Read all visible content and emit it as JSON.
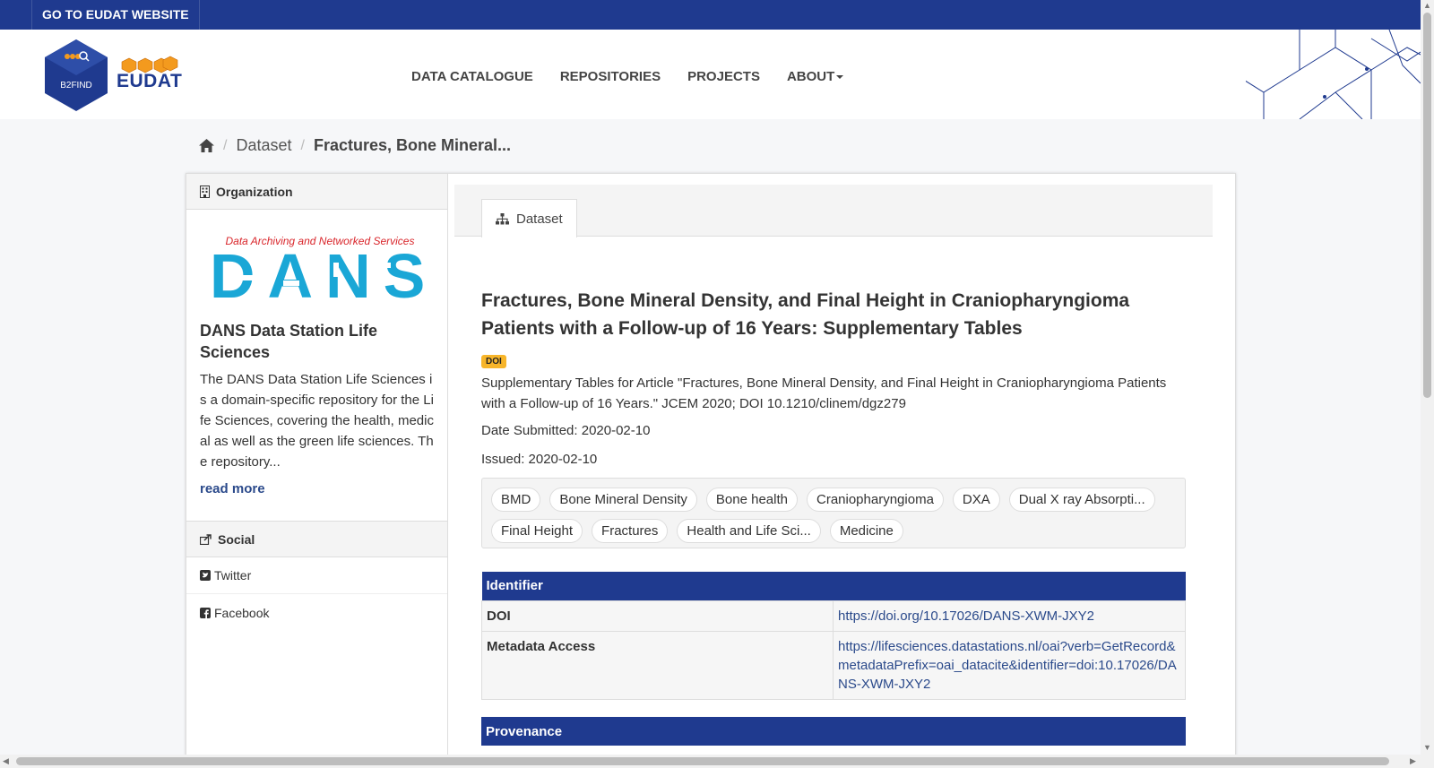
{
  "topbar": {
    "eudat_link": "GO TO EUDAT WEBSITE"
  },
  "header": {
    "b2find_logo_text": "B2FIND",
    "eudat_logo_text": "EUDAT",
    "nav": [
      {
        "label": "DATA CATALOGUE"
      },
      {
        "label": "REPOSITORIES"
      },
      {
        "label": "PROJECTS"
      },
      {
        "label": "ABOUT"
      }
    ]
  },
  "breadcrumb": {
    "dataset": "Dataset",
    "current": "Fractures, Bone Mineral..."
  },
  "sidebar": {
    "organization_heading": "Organization",
    "dans_logo_tagline": "Data Archiving and Networked Services",
    "dans_logo_word": "DANS",
    "org_title": "DANS Data Station Life Sciences",
    "org_description": "The DANS Data Station Life Sciences is a domain-specific repository for the Life Sciences, covering the health, medical as well as the green life sciences. The repository...",
    "read_more": "read more",
    "social_heading": "Social",
    "twitter": "Twitter",
    "facebook": "Facebook"
  },
  "content": {
    "tab_label": "Dataset",
    "title": "Fractures, Bone Mineral Density, and Final Height in Craniopharyngioma Patients with a Follow-up of 16 Years: Supplementary Tables",
    "badge": "DOI",
    "description": "Supplementary Tables for Article \"Fractures, Bone Mineral Density, and Final Height in Craniopharyngioma Patients with a Follow-up of 16 Years.\" JCEM 2020; DOI 10.1210/clinem/dgz279",
    "date_submitted": "Date Submitted: 2020-02-10",
    "issued": "Issued: 2020-02-10",
    "tags": [
      "BMD",
      "Bone Mineral Density",
      "Bone health",
      "Craniopharyngioma",
      "DXA",
      "Dual X ray Absorpti...",
      "Final Height",
      "Fractures",
      "Health and Life Sci...",
      "Medicine"
    ],
    "identifier_table": {
      "heading": "Identifier",
      "doi_label": "DOI",
      "doi_value": "https://doi.org/10.17026/DANS-XWM-JXY2",
      "metadata_label": "Metadata Access",
      "metadata_value": "https://lifesciences.datastations.nl/oai?verb=GetRecord&metadataPrefix=oai_datacite&identifier=doi:10.17026/DANS-XWM-JXY2"
    },
    "provenance_heading": "Provenance"
  },
  "colors": {
    "brand_blue": "#1f3a8f",
    "badge_yellow": "#f7b52a",
    "dans_cyan": "#1aa7d6",
    "dans_red": "#d9262b"
  }
}
